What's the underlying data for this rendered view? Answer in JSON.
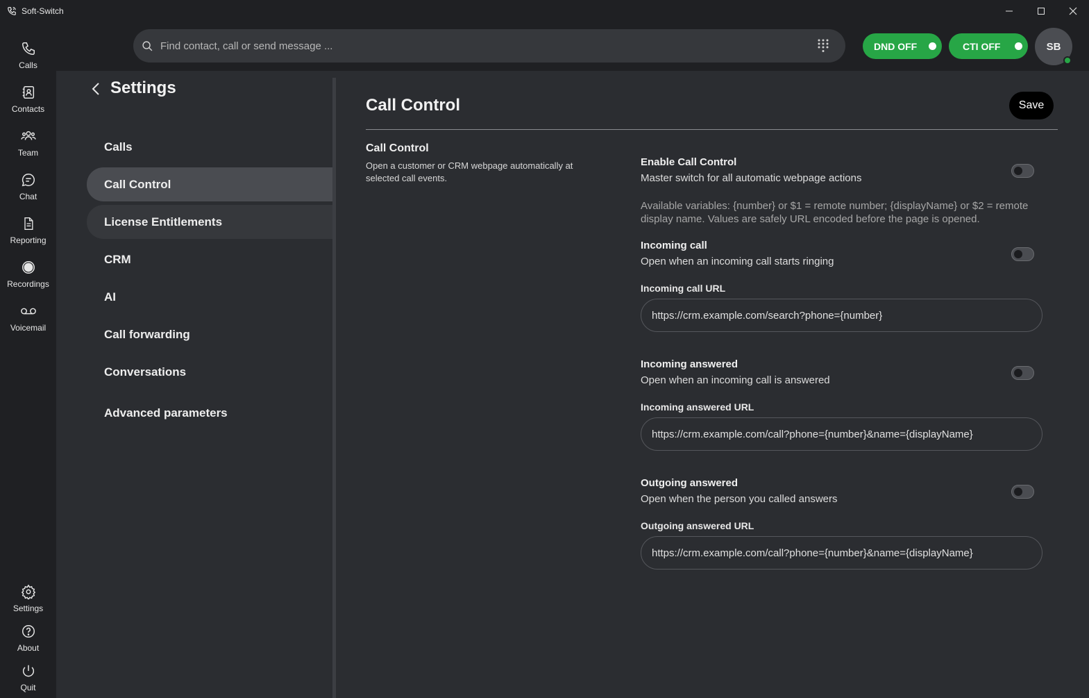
{
  "window": {
    "title": "Soft-Switch"
  },
  "rail": {
    "items": [
      {
        "label": "Calls",
        "icon": "phone-icon"
      },
      {
        "label": "Contacts",
        "icon": "contacts-icon"
      },
      {
        "label": "Team",
        "icon": "team-icon"
      },
      {
        "label": "Chat",
        "icon": "chat-icon"
      },
      {
        "label": "Reporting",
        "icon": "document-icon"
      },
      {
        "label": "Recordings",
        "icon": "record-icon"
      },
      {
        "label": "Voicemail",
        "icon": "voicemail-icon"
      }
    ],
    "bottom": [
      {
        "label": "Settings",
        "icon": "gear-icon"
      },
      {
        "label": "About",
        "icon": "help-icon"
      },
      {
        "label": "Quit",
        "icon": "power-icon"
      }
    ]
  },
  "header": {
    "search_placeholder": "Find contact, call or send message ...",
    "dnd_label": "DND OFF",
    "cti_label": "CTI OFF",
    "avatar_initials": "SB",
    "pill_color": "#27a646"
  },
  "settings": {
    "title": "Settings",
    "nav": [
      {
        "label": "Calls"
      },
      {
        "label": "Call Control"
      },
      {
        "label": "License Entitlements"
      },
      {
        "label": "CRM"
      },
      {
        "label": "AI"
      },
      {
        "label": "Call forwarding"
      },
      {
        "label": "Conversations"
      },
      {
        "label": "Advanced parameters"
      }
    ],
    "active": "Call Control"
  },
  "main": {
    "title": "Call Control",
    "save_label": "Save",
    "section": {
      "title": "Call Control",
      "description": "Open a customer or CRM webpage automatically at selected call events."
    },
    "enable": {
      "title": "Enable Call Control",
      "description": "Master switch for all automatic webpage actions",
      "enabled": false
    },
    "variables_note": "Available variables: {number} or $1 = remote number; {displayName} or $2 = remote display name. Values are safely URL encoded before the page is opened.",
    "options": [
      {
        "title": "Incoming call",
        "description": "Open when an incoming call starts ringing",
        "enabled": false,
        "url_label": "Incoming call URL",
        "url_value": "https://crm.example.com/search?phone={number}"
      },
      {
        "title": "Incoming answered",
        "description": "Open when an incoming call is answered",
        "enabled": false,
        "url_label": "Incoming answered URL",
        "url_value": "https://crm.example.com/call?phone={number}&name={displayName}"
      },
      {
        "title": "Outgoing answered",
        "description": "Open when the person you called answers",
        "enabled": false,
        "url_label": "Outgoing answered URL",
        "url_value": "https://crm.example.com/call?phone={number}&name={displayName}"
      }
    ]
  }
}
